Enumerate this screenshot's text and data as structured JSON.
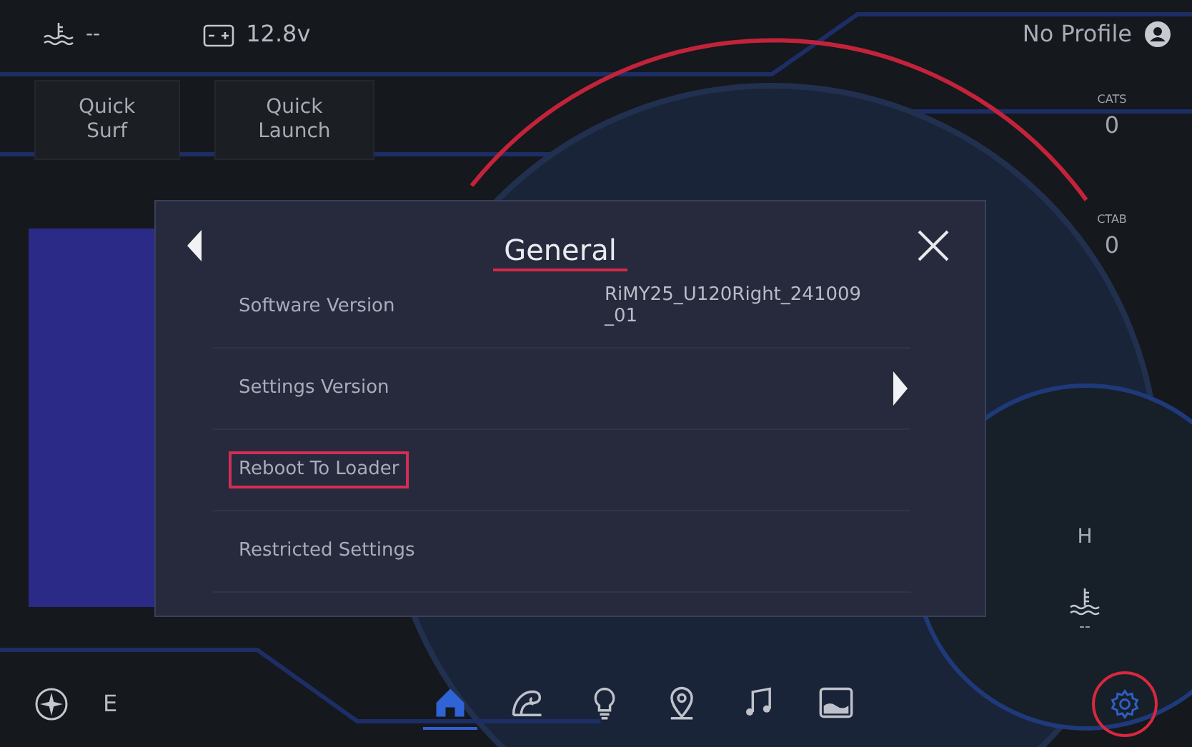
{
  "status_bar": {
    "water_temp": "--",
    "battery": "12.8v",
    "profile": "No Profile"
  },
  "quick_buttons": [
    {
      "label": "Quick Surf"
    },
    {
      "label": "Quick Launch"
    }
  ],
  "side_gauges": [
    {
      "label": "CATS",
      "value": "0"
    },
    {
      "label": "CTAB",
      "value": "0"
    }
  ],
  "engine_gauge": {
    "mark": "H",
    "reading": "--"
  },
  "dialog": {
    "title": "General",
    "rows": [
      {
        "label": "Software Version",
        "kind": "value",
        "value": "RiMY25_U120Right_241009_01",
        "highlighted": false
      },
      {
        "label": "Settings Version",
        "kind": "arrow",
        "highlighted": false
      },
      {
        "label": "Reboot To Loader",
        "kind": "plain",
        "highlighted": true
      },
      {
        "label": "Restricted Settings",
        "kind": "plain",
        "highlighted": false
      }
    ]
  },
  "bottom_bar": {
    "heading": "E",
    "nav": [
      {
        "kind": "home",
        "selected": true
      },
      {
        "kind": "wave",
        "selected": false
      },
      {
        "kind": "bulb",
        "selected": false
      },
      {
        "kind": "pin",
        "selected": false
      },
      {
        "kind": "music",
        "selected": false
      },
      {
        "kind": "display",
        "selected": false
      }
    ],
    "settings": {
      "circled": true
    }
  }
}
